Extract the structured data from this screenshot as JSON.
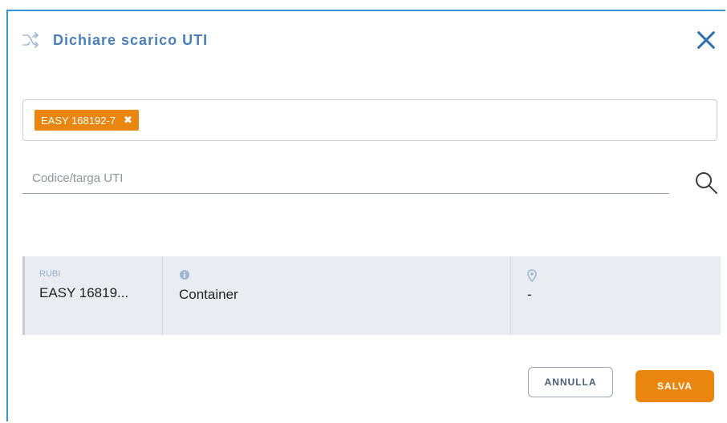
{
  "dialog": {
    "title": "Dichiare scarico UTI",
    "title_icon": "shuffle-icon",
    "close_icon": "close-icon"
  },
  "selected_tags": [
    {
      "label": "EASY 168192-7",
      "remove_icon": "✖"
    }
  ],
  "search": {
    "placeholder": "Codice/targa UTI",
    "value": "",
    "icon": "search-icon"
  },
  "result": {
    "col1": {
      "label": "RUBI",
      "value": "EASY 16819..."
    },
    "col2": {
      "icon": "info-icon",
      "value": "Container"
    },
    "col3": {
      "icon": "location-pin-icon",
      "value": "-"
    }
  },
  "buttons": {
    "cancel": "ANNULLA",
    "save": "SALVA"
  },
  "colors": {
    "accent": "#e8860f",
    "title": "#4a7fb8",
    "border": "#3a93d6"
  }
}
